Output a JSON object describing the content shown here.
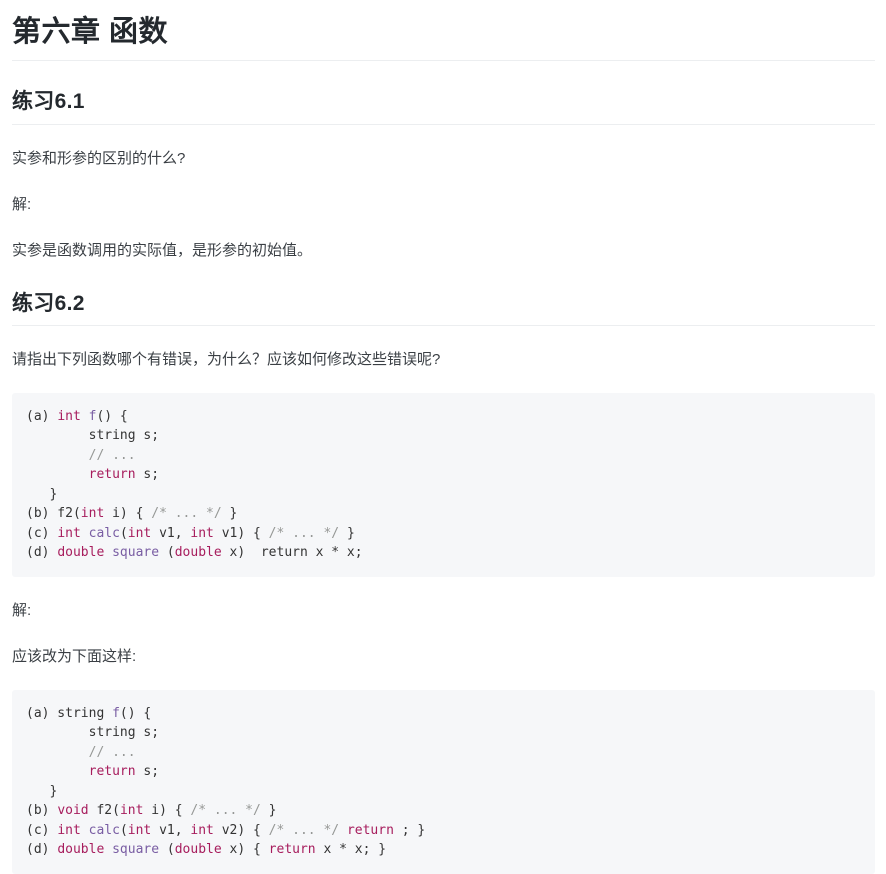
{
  "document": {
    "chapter_title": "第六章 函数",
    "sections": [
      {
        "heading": "练习6.1",
        "question": "实参和形参的区别的什么?",
        "answer_label": "解:",
        "answer_text": "实参是函数调用的实际值，是形参的初始值。"
      },
      {
        "heading": "练习6.2",
        "question": "请指出下列函数哪个有错误，为什么？应该如何修改这些错误呢?",
        "answer_label": "解:",
        "answer_note": "应该改为下面这样:"
      }
    ]
  },
  "code_block_1": {
    "lines": [
      [
        {
          "t": "(a) ",
          "c": "pl"
        },
        {
          "t": "int",
          "c": "k"
        },
        {
          "t": " ",
          "c": "pl"
        },
        {
          "t": "f",
          "c": "fn"
        },
        {
          "t": "() {",
          "c": "pl"
        }
      ],
      [
        {
          "t": "        string s;",
          "c": "pl"
        }
      ],
      [
        {
          "t": "        ",
          "c": "pl"
        },
        {
          "t": "// ...",
          "c": "cm"
        }
      ],
      [
        {
          "t": "        ",
          "c": "pl"
        },
        {
          "t": "return",
          "c": "k"
        },
        {
          "t": " s;",
          "c": "pl"
        }
      ],
      [
        {
          "t": "   }",
          "c": "pl"
        }
      ],
      [
        {
          "t": "(b) f2(",
          "c": "pl"
        },
        {
          "t": "int",
          "c": "k"
        },
        {
          "t": " i) { ",
          "c": "pl"
        },
        {
          "t": "/* ... */",
          "c": "cm"
        },
        {
          "t": " }",
          "c": "pl"
        }
      ],
      [
        {
          "t": "(c) ",
          "c": "pl"
        },
        {
          "t": "int",
          "c": "k"
        },
        {
          "t": " ",
          "c": "pl"
        },
        {
          "t": "calc",
          "c": "fn"
        },
        {
          "t": "(",
          "c": "pl"
        },
        {
          "t": "int",
          "c": "k"
        },
        {
          "t": " v1, ",
          "c": "pl"
        },
        {
          "t": "int",
          "c": "k"
        },
        {
          "t": " v1) { ",
          "c": "pl"
        },
        {
          "t": "/* ... */",
          "c": "cm"
        },
        {
          "t": " }",
          "c": "pl"
        }
      ],
      [
        {
          "t": "(d) ",
          "c": "pl"
        },
        {
          "t": "double",
          "c": "k"
        },
        {
          "t": " ",
          "c": "pl"
        },
        {
          "t": "square",
          "c": "fn"
        },
        {
          "t": " (",
          "c": "pl"
        },
        {
          "t": "double",
          "c": "k"
        },
        {
          "t": " x)  return x * x;",
          "c": "pl"
        }
      ]
    ]
  },
  "code_block_2": {
    "lines": [
      [
        {
          "t": "(a) string ",
          "c": "pl"
        },
        {
          "t": "f",
          "c": "fn"
        },
        {
          "t": "() {",
          "c": "pl"
        }
      ],
      [
        {
          "t": "        string s;",
          "c": "pl"
        }
      ],
      [
        {
          "t": "        ",
          "c": "pl"
        },
        {
          "t": "// ...",
          "c": "cm"
        }
      ],
      [
        {
          "t": "        ",
          "c": "pl"
        },
        {
          "t": "return",
          "c": "k"
        },
        {
          "t": " s;",
          "c": "pl"
        }
      ],
      [
        {
          "t": "   }",
          "c": "pl"
        }
      ],
      [
        {
          "t": "(b) ",
          "c": "pl"
        },
        {
          "t": "void",
          "c": "k"
        },
        {
          "t": " f2(",
          "c": "pl"
        },
        {
          "t": "int",
          "c": "k"
        },
        {
          "t": " i) { ",
          "c": "pl"
        },
        {
          "t": "/* ... */",
          "c": "cm"
        },
        {
          "t": " }",
          "c": "pl"
        }
      ],
      [
        {
          "t": "(c) ",
          "c": "pl"
        },
        {
          "t": "int",
          "c": "k"
        },
        {
          "t": " ",
          "c": "pl"
        },
        {
          "t": "calc",
          "c": "fn"
        },
        {
          "t": "(",
          "c": "pl"
        },
        {
          "t": "int",
          "c": "k"
        },
        {
          "t": " v1, ",
          "c": "pl"
        },
        {
          "t": "int",
          "c": "k"
        },
        {
          "t": " v2) { ",
          "c": "pl"
        },
        {
          "t": "/* ... */",
          "c": "cm"
        },
        {
          "t": " ",
          "c": "pl"
        },
        {
          "t": "return",
          "c": "k"
        },
        {
          "t": " ; }",
          "c": "pl"
        }
      ],
      [
        {
          "t": "(d) ",
          "c": "pl"
        },
        {
          "t": "double",
          "c": "k"
        },
        {
          "t": " ",
          "c": "pl"
        },
        {
          "t": "square",
          "c": "fn"
        },
        {
          "t": " (",
          "c": "pl"
        },
        {
          "t": "double",
          "c": "k"
        },
        {
          "t": " x) { ",
          "c": "pl"
        },
        {
          "t": "return",
          "c": "k"
        },
        {
          "t": " x * x; }",
          "c": "pl"
        }
      ]
    ]
  },
  "colors": {
    "keyword": "#a71d5d",
    "function_name": "#795da3",
    "comment": "#969896",
    "code_background": "#f6f7f9",
    "heading_text": "#24292e",
    "body_text": "#3a3f44",
    "rule": "#eceef0"
  }
}
